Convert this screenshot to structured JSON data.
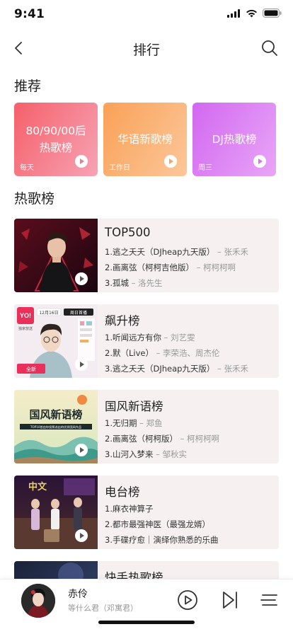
{
  "status": {
    "time": "9:41"
  },
  "nav": {
    "title": "排行"
  },
  "recommend": {
    "title": "推荐",
    "cards": [
      {
        "title": "80/90/00后\n热歌榜",
        "sub": "每天"
      },
      {
        "title": "华语新歌榜",
        "sub": "工作日"
      },
      {
        "title": "DJ热歌榜",
        "sub": "周三"
      }
    ]
  },
  "hot": {
    "title": "热歌榜",
    "charts": [
      {
        "name": "TOP500",
        "songs": [
          {
            "title": "1.逃之夭夭（DJheap九天版）",
            "artist": "– 张禾禾"
          },
          {
            "title": "2.画离弦（柯柯吉他版）",
            "artist": "– 柯柯柯啊"
          },
          {
            "title": "3.孤城",
            "artist": "– 洛先生"
          }
        ]
      },
      {
        "name": "飙升榜",
        "cover_text": {
          "badge": "YO!",
          "badge_sub": "独家放送",
          "date": "12月16日",
          "date_tag": "周日首播",
          "show": "全新"
        },
        "songs": [
          {
            "title": "1.听闻远方有你",
            "artist": "– 刘艺雯"
          },
          {
            "title": "2.默（Live）",
            "artist": "– 李荣浩、周杰伦"
          },
          {
            "title": "3.逃之夭夭（DJheap九天版）",
            "artist": "– 张禾禾"
          }
        ]
      },
      {
        "name": "国风新语榜",
        "cover_text": {
          "art_title": "国风新语榜",
          "art_sub": "TOP10首由你投票选出的优质国风作品"
        },
        "songs": [
          {
            "title": "1.无归期",
            "artist": "– 郑鱼"
          },
          {
            "title": "2.画离弦（柯柯版）",
            "artist": "– 柯柯柯啊"
          },
          {
            "title": "3.山河入梦来",
            "artist": "– 邹秋实"
          }
        ]
      },
      {
        "name": "电台榜",
        "cover_text": {
          "stage": "中文"
        },
        "songs": [
          {
            "title": "1.麻衣神算子",
            "artist": ""
          },
          {
            "title": "2.都市最强神医（最强龙婿）",
            "artist": ""
          },
          {
            "title": "3.手碟疗愈｜演绎你熟悉的乐曲",
            "artist": ""
          }
        ]
      },
      {
        "name": "快手热歌榜",
        "songs": []
      }
    ]
  },
  "player": {
    "title": "赤伶",
    "subtitle": "等什么君（邓寓君）"
  },
  "colors": {
    "card1": "#f5606a",
    "card2": "#f9a157",
    "card3": "#d268f0",
    "chart_bg": "#f6f0f0"
  },
  "icons": [
    "back-icon",
    "search-icon",
    "play-icon",
    "next-icon",
    "playlist-icon",
    "signal-icon",
    "wifi-icon",
    "battery-icon"
  ]
}
